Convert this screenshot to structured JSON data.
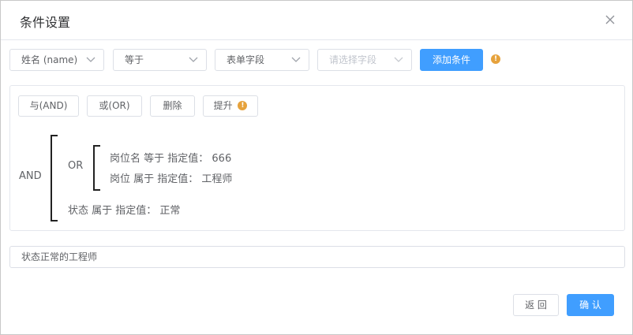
{
  "dialog": {
    "title": "条件设置"
  },
  "toolbar": {
    "field_select": "姓名 (name)",
    "operator_select": "等于",
    "value_type_select": "表单字段",
    "value_select_placeholder": "请选择字段",
    "add_condition_label": "添加条件",
    "warn_symbol": "!"
  },
  "actions": {
    "and_label": "与(AND)",
    "or_label": "或(OR)",
    "delete_label": "删除",
    "promote_label": "提升",
    "warn_symbol": "!"
  },
  "tree": {
    "root_op": "AND",
    "group_op": "OR",
    "group_conditions": [
      "岗位名 等于 指定值： 666",
      "岗位 属于 指定值： 工程师"
    ],
    "condition": "状态 属于 指定值： 正常"
  },
  "note": {
    "value": "状态正常的工程师"
  },
  "footer": {
    "back_label": "返 回",
    "confirm_label": "确 认"
  },
  "colors": {
    "primary": "#409eff",
    "warning": "#e6a23c",
    "border": "#dcdfe6"
  }
}
